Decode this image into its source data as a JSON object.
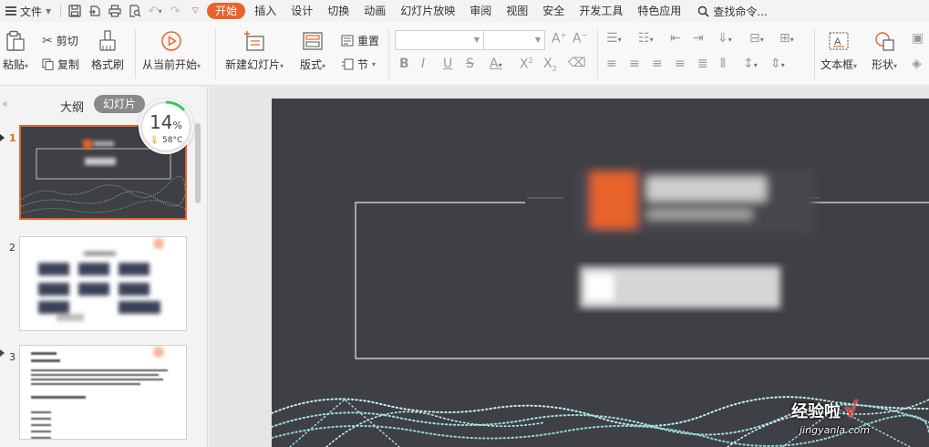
{
  "menubar": {
    "file_label": "文件",
    "tabs": [
      {
        "label": "开始",
        "active": true
      },
      {
        "label": "插入",
        "active": false
      },
      {
        "label": "设计",
        "active": false
      },
      {
        "label": "切换",
        "active": false
      },
      {
        "label": "动画",
        "active": false
      },
      {
        "label": "幻灯片放映",
        "active": false
      },
      {
        "label": "审阅",
        "active": false
      },
      {
        "label": "视图",
        "active": false
      },
      {
        "label": "安全",
        "active": false
      },
      {
        "label": "开发工具",
        "active": false
      },
      {
        "label": "特色应用",
        "active": false
      }
    ],
    "search_label": "查找命令..."
  },
  "ribbon": {
    "paste": "粘贴",
    "cut": "剪切",
    "copy": "复制",
    "format_painter": "格式刷",
    "play_from_current": "从当前开始",
    "new_slide": "新建幻灯片",
    "layout": "版式",
    "reset": "重置",
    "section": "节",
    "text_box": "文本框",
    "shape": "形状",
    "font_name": "",
    "font_size": ""
  },
  "leftpanel": {
    "tab_outline": "大纲",
    "tab_slides": "幻灯片",
    "slides": [
      {
        "number": "1",
        "selected": true
      },
      {
        "number": "2",
        "selected": false
      },
      {
        "number": "3",
        "selected": false
      }
    ]
  },
  "perf_widget": {
    "percent": "14",
    "percent_unit": "%",
    "temperature": "58°C"
  },
  "watermark": {
    "main": "经验啦",
    "check": "√",
    "sub": "jingyanla.com"
  },
  "colors": {
    "accent": "#e8632b",
    "slide_bg": "#3f3f46",
    "ribbon_bg": "#f8f8f8"
  }
}
